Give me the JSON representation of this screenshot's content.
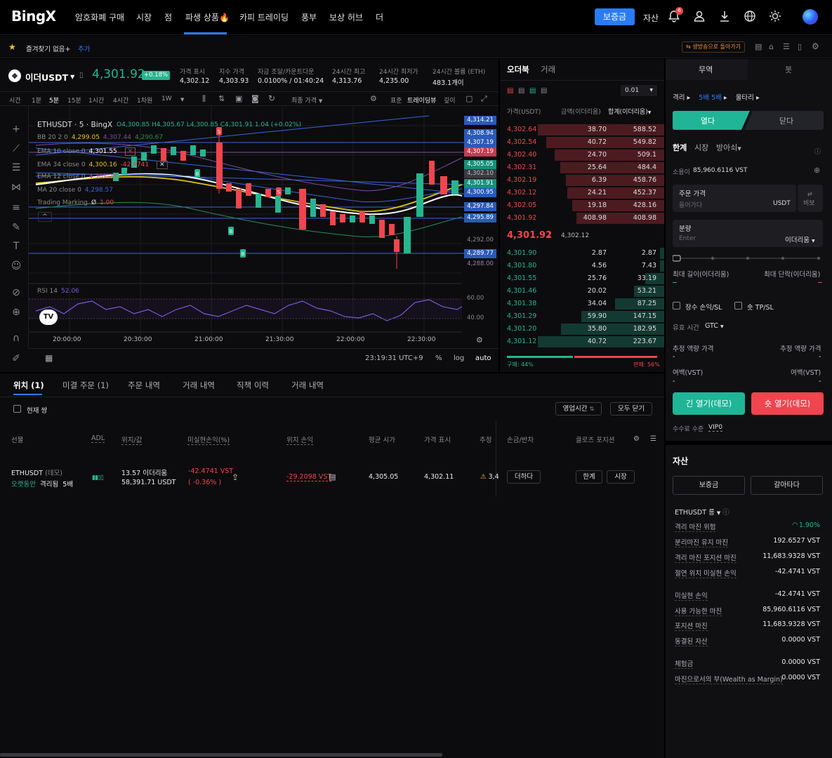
{
  "nav": {
    "logo": "BingX",
    "items": [
      "암호화폐 구매",
      "시장",
      "점",
      "파생 상품🔥",
      "카피 트레이딩",
      "풍부",
      "보상 허브",
      "더"
    ],
    "deposit": "보증금",
    "assets": "자산",
    "notif_count": "6"
  },
  "favbar": {
    "label": "즐겨찾기 없음+",
    "add": "추가",
    "right_link": "생방송으로 돌아가기"
  },
  "ticker": {
    "symbol": "이더USDT",
    "price": "4,301.92",
    "change": "+0.18%",
    "stats": [
      {
        "label": "가격 표시",
        "value": "4,302.12"
      },
      {
        "label": "지수 가격",
        "value": "4,303.93"
      },
      {
        "label": "자금 조달/카운트다운",
        "value": "0.0100% / 01:40:24"
      },
      {
        "label": "24시간 최고",
        "value": "4,313.76"
      },
      {
        "label": "24시간 최저가",
        "value": "4,235.00"
      },
      {
        "label": "24시간 볼륨 (ETH)",
        "value": "483.1개이"
      }
    ]
  },
  "chart_toolbar": {
    "intervals": [
      "시간",
      "1분",
      "5분",
      "15분",
      "1시간",
      "4시간",
      "1차원",
      "1W"
    ],
    "active": "5분",
    "price_type": "최종 가격",
    "views": [
      "표준",
      "트레이딩뷰",
      "깊이"
    ]
  },
  "chart": {
    "title": "ETHUSDT · 5 · BingX",
    "ohlc": "O4,300.85 H4,305.67 L4,300.85 C4,301.91 1.04 (+0.02%)",
    "indicators": [
      {
        "name": "BB 20 2 0",
        "v1": "4,299.05",
        "v2": "4,307.44",
        "v3": "4,290.67"
      },
      {
        "name": "EMA 10 close 0",
        "v1": "4,301.55"
      },
      {
        "name": "EMA 34 close 0",
        "v1": "4,300.16",
        "v2": "-42.4741"
      },
      {
        "name": "EMA 12 close 0",
        "v1": "4,301.23"
      },
      {
        "name": "MA 20 close 0",
        "v1": "4,298.57"
      },
      {
        "name": "Trading Marking",
        "v1": "Ø",
        "v2": "1.00"
      }
    ],
    "price_tags": [
      {
        "label": "4,314.21",
        "color": "#2a5ab8"
      },
      {
        "label": "4,308.94",
        "color": "#2a5ab8"
      },
      {
        "label": "4,307.19",
        "color": "#2a5ab8"
      },
      {
        "label": "4,307.19",
        "color": "#c23b54"
      },
      {
        "label": "4,305.05",
        "color": "#17907a"
      },
      {
        "label": "4,302.10",
        "color": "#3a3a40"
      },
      {
        "label": "4,301.91",
        "color": "#17907a"
      },
      {
        "label": "4,300.95",
        "color": "#2a5ab8"
      },
      {
        "label": "4,297.84",
        "color": "#2a5ab8"
      },
      {
        "label": "4,295.89",
        "color": "#2a5ab8"
      },
      {
        "label": "4,292.00",
        "color": ""
      },
      {
        "label": "4,289.77",
        "color": "#2a5ab8"
      },
      {
        "label": "4,288.00",
        "color": ""
      }
    ],
    "rsi_label": "RSI 14",
    "rsi_value": "52.06",
    "rsi_axis": [
      "60.00",
      "40.00"
    ],
    "time_axis": [
      "20:00:00",
      "20:30:00",
      "21:00:00",
      "21:30:00",
      "22:00:00",
      "22:30:00"
    ],
    "clock": "23:19:31 UTC+9",
    "pct": "%",
    "log": "log",
    "auto": "auto"
  },
  "book": {
    "tabs": [
      "오더북",
      "거래"
    ],
    "step": "0.01",
    "headers": [
      "가격(USDT)",
      "금액(이더리움)",
      "합계(이더리움)"
    ],
    "asks": [
      [
        "4,302.64",
        "38.70",
        "588.52"
      ],
      [
        "4,302.54",
        "40.72",
        "549.82"
      ],
      [
        "4,302.40",
        "24.70",
        "509.1"
      ],
      [
        "4,302.31",
        "25.64",
        "484.4"
      ],
      [
        "4,302.19",
        "6.39",
        "458.76"
      ],
      [
        "4,302.12",
        "24.21",
        "452.37"
      ],
      [
        "4,302.05",
        "19.18",
        "428.16"
      ],
      [
        "4,301.92",
        "408.98",
        "408.98"
      ]
    ],
    "mid_price": "4,301.92",
    "mid_mark": "4,302.12",
    "bids": [
      [
        "4,301.90",
        "2.87",
        "2.87"
      ],
      [
        "4,301.80",
        "4.56",
        "7.43"
      ],
      [
        "4,301.55",
        "25.76",
        "33.19"
      ],
      [
        "4,301.46",
        "20.02",
        "53.21"
      ],
      [
        "4,301.38",
        "34.04",
        "87.25"
      ],
      [
        "4,301.29",
        "59.90",
        "147.15"
      ],
      [
        "4,301.20",
        "35.80",
        "182.95"
      ],
      [
        "4,301.12",
        "40.72",
        "223.67"
      ]
    ],
    "buy_pct": "구매: 44%",
    "sell_pct": "판매: 56%"
  },
  "order": {
    "tabs": [
      "무역",
      "봇"
    ],
    "margin": "격리",
    "leverage": "5배 5배",
    "mode": "울타리",
    "open": "열다",
    "close": "닫다",
    "types": [
      "한계",
      "시장",
      "방아쇠"
    ],
    "available_label": "소용이",
    "available_value": "85,960.6116 VST",
    "price_label": "주문 가격",
    "price_placeholder": "들어가다",
    "price_unit": "USDT",
    "bbo": "비보",
    "qty_label": "분량",
    "qty_placeholder": "Enter",
    "qty_unit": "이더리움",
    "max_long": "최대 길이(이더리움)",
    "max_short": "최대 단락(이더리움)",
    "tp_long": "장수 손익/SL",
    "tp_short": "숏 TP/SL",
    "tif_label": "유효 시간",
    "tif_value": "GTC",
    "liq_long": "추정 액량 가격",
    "liq_short": "추정 액량 가격",
    "margin_long": "여백(VST)",
    "margin_short": "여백(VST)",
    "dash": "-",
    "long_btn": "긴 열기(데모)",
    "short_btn": "숏 열기(데모)",
    "fee_label": "수수료 수준",
    "fee_value": "VIP0"
  },
  "assets": {
    "title": "자산",
    "deposit": "보증금",
    "transfer": "갈아타다",
    "pair": "ETHUSDT 릉",
    "rows": [
      {
        "label": "격리 마진 위험",
        "value": "1.90%"
      },
      {
        "label": "분리마진 유지 마진",
        "value": "192.6527 VST"
      },
      {
        "label": "격리 마진 포지션 마진",
        "value": "11,683.9328 VST"
      },
      {
        "label": "절연 위치 미실현 손익",
        "value": "-42.4741 VST"
      },
      {
        "label": "미실현 손익",
        "value": "-42.4741 VST"
      },
      {
        "label": "사용 가능한 마진",
        "value": "85,960.6116 VST"
      },
      {
        "label": "포지션 마진",
        "value": "11,683.9328 VST"
      },
      {
        "label": "동결된 자산",
        "value": "0.0000 VST"
      },
      {
        "label": "체험금",
        "value": "0.0000 VST"
      },
      {
        "label": "마진으로서의 부(Wealth as Margin)",
        "value": "0.0000 VST"
      }
    ]
  },
  "positions": {
    "tabs": [
      "위치 (1)",
      "미결 주문 (1)",
      "주문 내역",
      "거래 내역",
      "직책 이력",
      "거래 내역"
    ],
    "current_pair": "현재 쌍",
    "sort_btn": "영업시간",
    "close_all": "모두 닫기",
    "headers": [
      "선물",
      "ADL",
      "위치/값",
      "미실현손익(%)",
      "위치 손익",
      "평균 시가",
      "가격 표시",
      "추정",
      "손금/반차",
      "클로즈 포지션"
    ],
    "row": {
      "pair": "ETHUSDT",
      "demo": "(데모)",
      "side": "오랫동안",
      "margin": "격리됨",
      "lev": "5배",
      "size": "13.57 이더리움",
      "value": "58,391.71 USDT",
      "pnl": "-42.4741 VST",
      "pnl_pct": "( -0.36% )",
      "pos_pnl": "-29.2098 VST",
      "avg": "4,305.05",
      "mark": "4,302.11",
      "est": "3,4",
      "add": "더하다",
      "limit": "한계",
      "market": "시장"
    }
  }
}
